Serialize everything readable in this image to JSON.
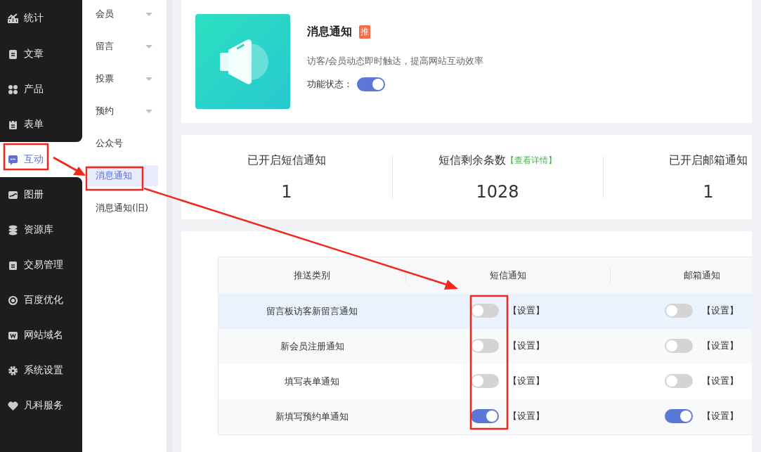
{
  "sidebar": {
    "items": [
      {
        "label": "统计",
        "selected": false
      },
      {
        "label": "文章",
        "selected": false
      },
      {
        "label": "产品",
        "selected": false
      },
      {
        "label": "表单",
        "selected": false
      },
      {
        "label": "互动",
        "selected": true
      },
      {
        "label": "图册",
        "selected": false
      },
      {
        "label": "资源库",
        "selected": false
      },
      {
        "label": "交易管理",
        "selected": false
      },
      {
        "label": "百度优化",
        "selected": false
      },
      {
        "label": "网站域名",
        "selected": false
      },
      {
        "label": "系统设置",
        "selected": false
      },
      {
        "label": "凡科服务",
        "selected": false
      }
    ]
  },
  "submenu": {
    "items": [
      {
        "label": "会员",
        "expandable": true,
        "selected": false
      },
      {
        "label": "留言",
        "expandable": true,
        "selected": false
      },
      {
        "label": "投票",
        "expandable": true,
        "selected": false
      },
      {
        "label": "预约",
        "expandable": true,
        "selected": false
      },
      {
        "label": "公众号",
        "expandable": false,
        "selected": false
      },
      {
        "label": "消息通知",
        "expandable": false,
        "selected": true
      },
      {
        "label": "消息通知(旧)",
        "expandable": false,
        "selected": false
      }
    ]
  },
  "feature": {
    "title": "消息通知",
    "badge": "推",
    "description": "访客/会员动态即时触达，提高网站互动效率",
    "status_label": "功能状态：",
    "status_on": true
  },
  "stats": [
    {
      "label": "已开启短信通知",
      "value": "1"
    },
    {
      "label": "短信剩余条数",
      "link": "【查看详情】",
      "value": "1028"
    },
    {
      "label": "已开启邮箱通知",
      "value": "1"
    }
  ],
  "table": {
    "columns": [
      "推送类别",
      "短信通知",
      "邮箱通知"
    ],
    "rows": [
      {
        "name": "留言板访客新留言通知",
        "highlighted": true,
        "sms_on": false,
        "sms_settings": "【设置】",
        "email_on": false,
        "email_settings": "【设置】"
      },
      {
        "name": "新会员注册通知",
        "highlighted": false,
        "sms_on": false,
        "sms_settings": "【设置】",
        "email_on": false,
        "email_settings": "【设置】"
      },
      {
        "name": "填写表单通知",
        "highlighted": false,
        "sms_on": false,
        "sms_settings": "【设置】",
        "email_on": false,
        "email_settings": "【设置】"
      },
      {
        "name": "新填写预约单通知",
        "highlighted": false,
        "sms_on": true,
        "sms_settings": "【设置】",
        "email_on": true,
        "email_settings": "【设置】"
      }
    ]
  }
}
